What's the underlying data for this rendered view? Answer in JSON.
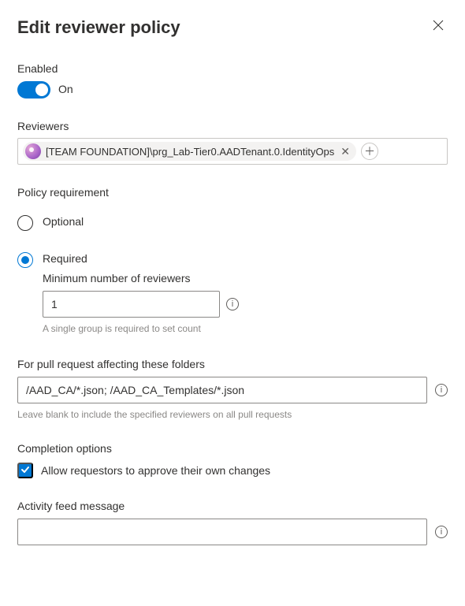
{
  "dialog": {
    "title": "Edit reviewer policy"
  },
  "enabled": {
    "label": "Enabled",
    "state_label": "On",
    "on": true
  },
  "reviewers": {
    "label": "Reviewers",
    "chip_name": "[TEAM FOUNDATION]\\prg_Lab-Tier0.AADTenant.0.IdentityOps"
  },
  "policy_requirement": {
    "label": "Policy requirement",
    "optional_label": "Optional",
    "required_label": "Required",
    "selected": "required",
    "min_reviewers_label": "Minimum number of reviewers",
    "min_reviewers_value": "1",
    "min_reviewers_hint": "A single group is required to set count"
  },
  "folders": {
    "label": "For pull request affecting these folders",
    "value": "/AAD_CA/*.json; /AAD_CA_Templates/*.json",
    "hint": "Leave blank to include the specified reviewers on all pull requests"
  },
  "completion": {
    "label": "Completion options",
    "allow_self_approve_label": "Allow requestors to approve their own changes",
    "allow_self_approve_checked": true
  },
  "activity_feed": {
    "label": "Activity feed message",
    "value": ""
  }
}
